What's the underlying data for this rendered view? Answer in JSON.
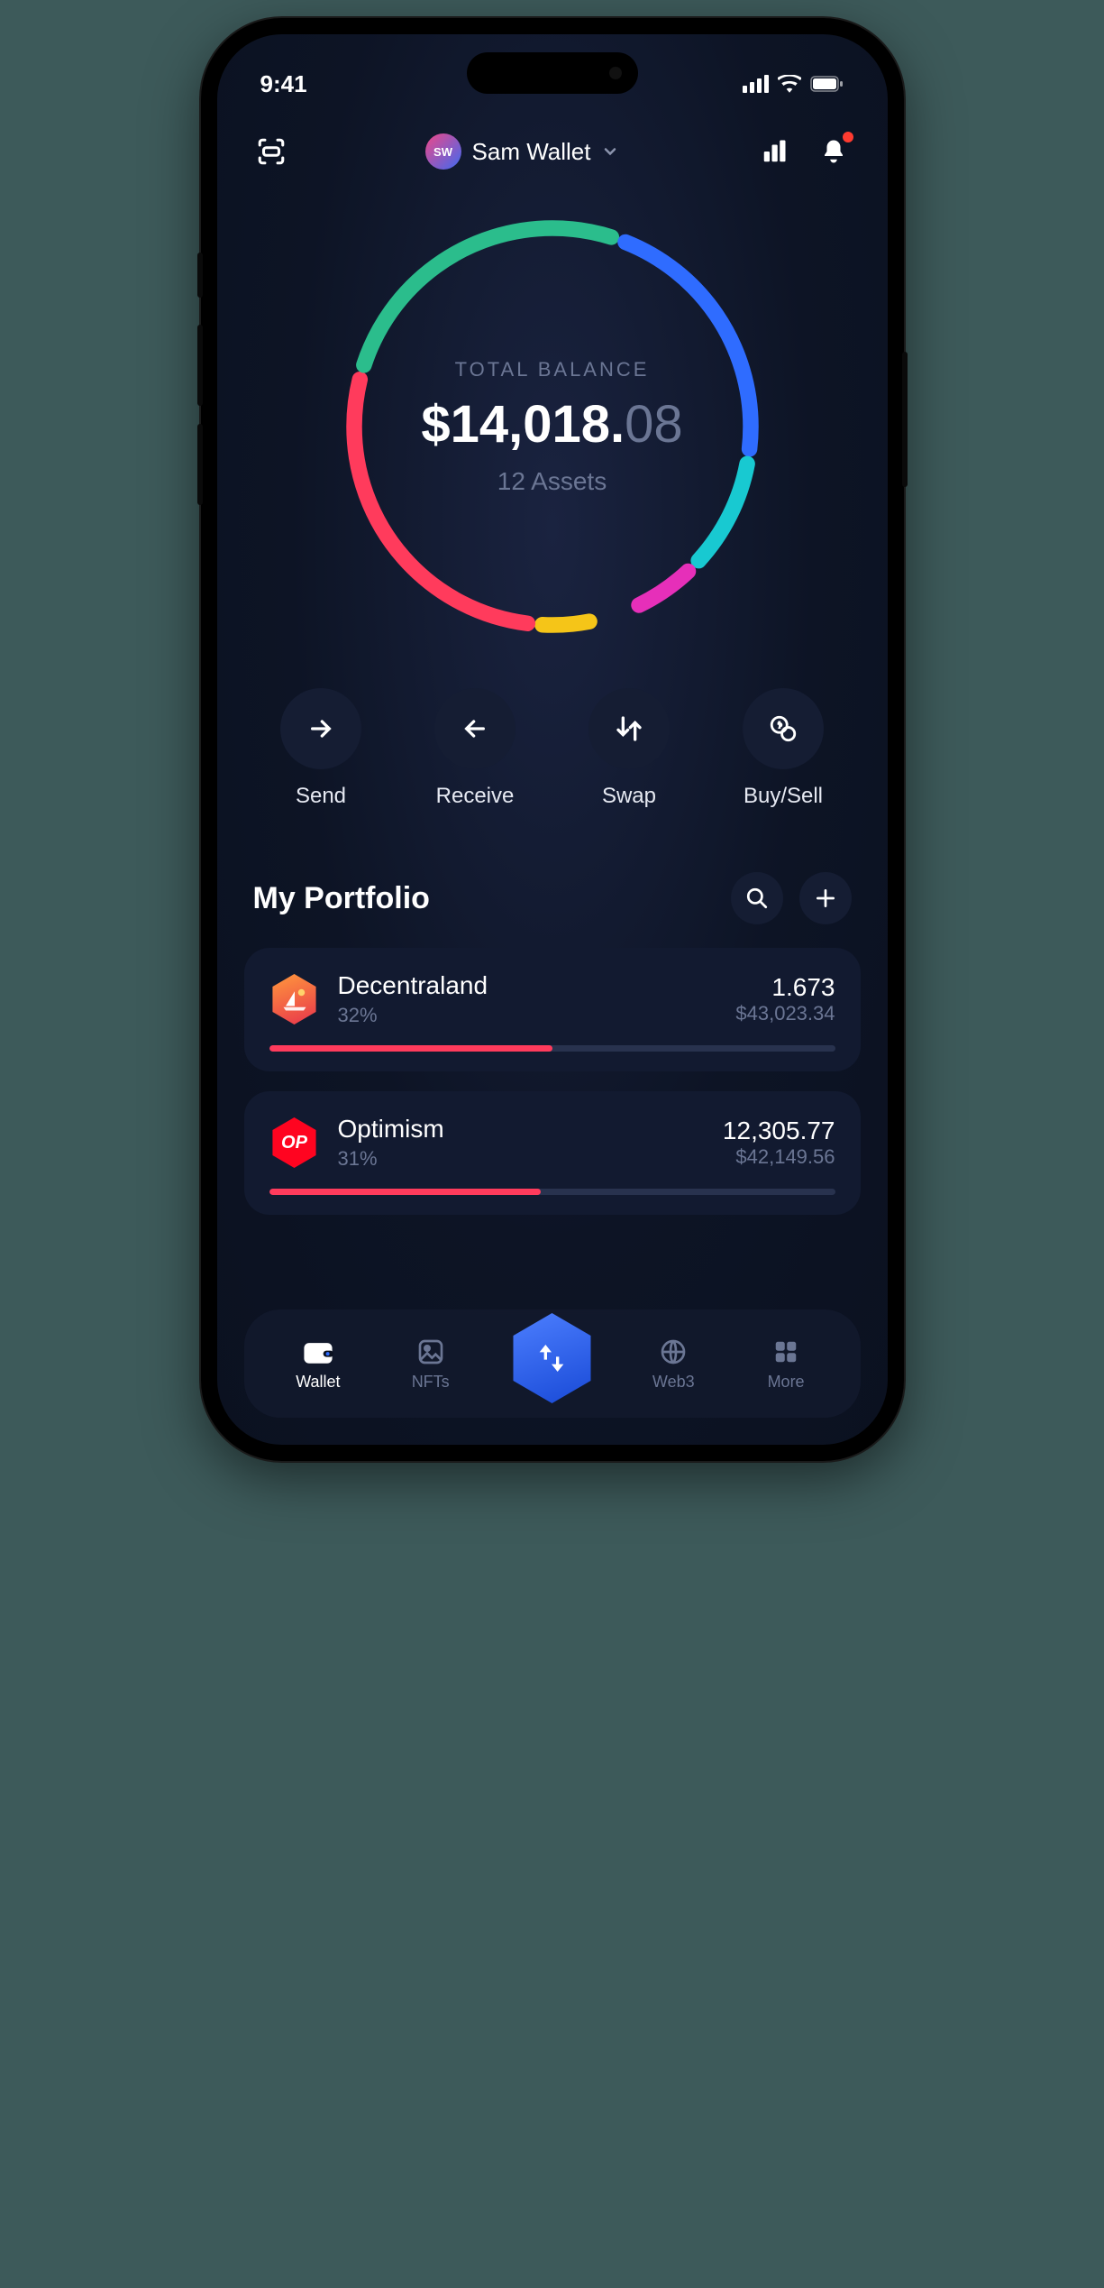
{
  "status": {
    "time": "9:41"
  },
  "header": {
    "wallet_initials": "SW",
    "wallet_name": "Sam Wallet"
  },
  "balance": {
    "label": "TOTAL BALANCE",
    "currency": "$",
    "whole": "14,018.",
    "cents": "08",
    "assets_text": "12 Assets"
  },
  "donut_segments": [
    {
      "color": "#f5c518",
      "pct": 5
    },
    {
      "color": "#ff3b5c",
      "pct": 28
    },
    {
      "color": "#2bbd8c",
      "pct": 26
    },
    {
      "color": "#2f6cff",
      "pct": 22
    },
    {
      "color": "#18c9d1",
      "pct": 10
    },
    {
      "color": "#e62fb9",
      "pct": 6
    }
  ],
  "actions": {
    "send": "Send",
    "receive": "Receive",
    "swap": "Swap",
    "buysell": "Buy/Sell"
  },
  "portfolio": {
    "title": "My Portfolio",
    "items": [
      {
        "name": "Decentraland",
        "pct_text": "32%",
        "amount": "1.673",
        "usd": "$43,023.34",
        "bar_pct": 50,
        "bar_color": "#ff3b5c",
        "icon_bg": "linear-gradient(160deg,#ff9a3c,#e8334c)",
        "icon_svg": "sailboat"
      },
      {
        "name": "Optimism",
        "pct_text": "31%",
        "amount": "12,305.77",
        "usd": "$42,149.56",
        "bar_pct": 48,
        "bar_color": "#ff3b5c",
        "icon_bg": "#ff0420",
        "icon_text": "OP"
      }
    ]
  },
  "nav": {
    "wallet": "Wallet",
    "nfts": "NFTs",
    "web3": "Web3",
    "more": "More"
  }
}
